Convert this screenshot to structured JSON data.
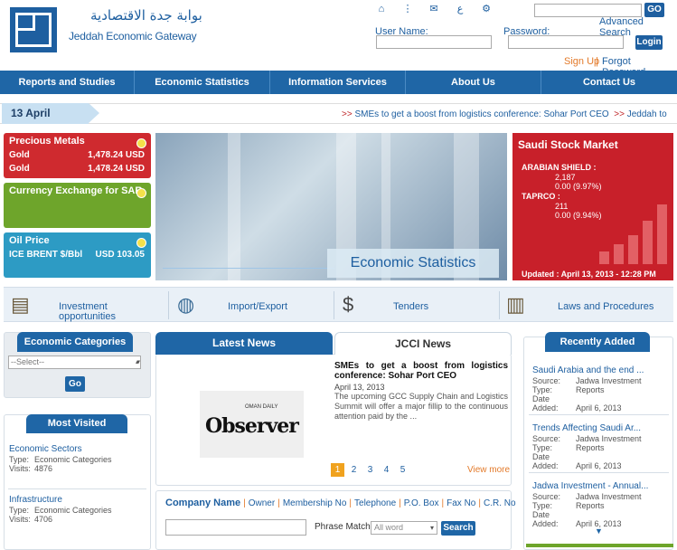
{
  "header": {
    "logo_arabic": "بوابة جدة الاقتصادية",
    "logo_english": "Jeddah Economic Gateway",
    "top_icons": [
      "home-icon",
      "sitemap-icon",
      "mail-icon",
      "arabic-icon",
      "gear-icon"
    ],
    "arabic_glyph": "ع",
    "go_label": "GO",
    "advanced_search": "Advanced Search",
    "username_label": "User Name:",
    "password_label": "Password:",
    "login_label": "Login",
    "signup_label": "Sign Up",
    "separator": "|",
    "forgot_label": "Forgot Password"
  },
  "nav": {
    "items": [
      "Reports and Studies",
      "Economic Statistics",
      "Information Services",
      "About Us",
      "Contact Us"
    ]
  },
  "ticker": {
    "date": "13 April",
    "arrow1": ">>",
    "text1": "SMEs to get a boost from logistics conference: Sohar Port CEO",
    "arrow2": ">>",
    "text2": "Jeddah to"
  },
  "widgets": {
    "metals": {
      "title": "Precious Metals",
      "rows": [
        {
          "name": "Gold",
          "value": "1,478.24 USD"
        },
        {
          "name": "Gold",
          "value": "1,478.24 USD"
        }
      ]
    },
    "currency": {
      "title": "Currency Exchange for SAR"
    },
    "oil": {
      "title": "Oil Price",
      "row_name": "ICE BRENT $/Bbl",
      "row_value": "USD 103.05"
    }
  },
  "banner": {
    "caption": "Economic Statistics"
  },
  "stock": {
    "title": "Saudi Stock Market",
    "companies": [
      {
        "name": "ARABIAN SHIELD :",
        "price": "2,187",
        "change": "0.00 (9.97%)"
      },
      {
        "name": "TAPRCO :",
        "price": "211",
        "change": "0.00 (9.94%)"
      }
    ],
    "updated": "Updated : April 13, 2013 - 12:28 PM"
  },
  "quick_links": [
    {
      "label1": "Investment",
      "label2": "opportunities",
      "icon": "wallet-icon"
    },
    {
      "label1": "Import/Export",
      "label2": "",
      "icon": "globe-icon"
    },
    {
      "label1": "Tenders",
      "label2": "",
      "icon": "money-bag-icon"
    },
    {
      "label1": "Laws and Procedures",
      "label2": "",
      "icon": "books-gavel-icon"
    }
  ],
  "categories": {
    "title": "Economic Categories",
    "select_value": "--Select--",
    "go_label": "Go"
  },
  "most_visited": {
    "title": "Most Visited",
    "type_label": "Type:",
    "visits_label": "Visits:",
    "items": [
      {
        "title": "Economic Sectors",
        "type": "Economic Categories",
        "visits": "4876"
      },
      {
        "title": "Infrastructure",
        "type": "Economic Categories",
        "visits": "4706"
      }
    ]
  },
  "news": {
    "tab_latest": "Latest News",
    "tab_jcci": "JCCI News",
    "image_brand": "Observer",
    "image_small": "OMAN DAILY",
    "headline": "SMEs to get a boost from logistics conference: Sohar Port CEO",
    "date": "April 13, 2013",
    "body": "The upcoming GCC Supply Chain and Logistics Summit will offer a major fillip to the continuous attention paid by the ...",
    "pages": [
      "1",
      "2",
      "3",
      "4",
      "5"
    ],
    "view_more": "View more"
  },
  "directory": {
    "links": [
      "Company Name",
      "Owner",
      "Membership No",
      "Telephone",
      "P.O. Box",
      "Fax No",
      "C.R. No"
    ],
    "phrase_label": "Phrase Match:",
    "phrase_value": "All word",
    "search_label": "Search"
  },
  "recently_added": {
    "title": "Recently Added",
    "source_label": "Source:",
    "type_label": "Type:",
    "date_label": "Date Added:",
    "items": [
      {
        "title": "Saudi Arabia and the end ...",
        "source": "Jadwa Investment",
        "type": "Reports",
        "date": "April 6, 2013"
      },
      {
        "title": "Trends Affecting Saudi Ar...",
        "source": "Jadwa Investment",
        "type": "Reports",
        "date": "April 6, 2013"
      },
      {
        "title": "Jadwa Investment - Annual...",
        "source": "Jadwa Investment",
        "type": "Reports",
        "date": "April 6, 2013"
      }
    ]
  }
}
